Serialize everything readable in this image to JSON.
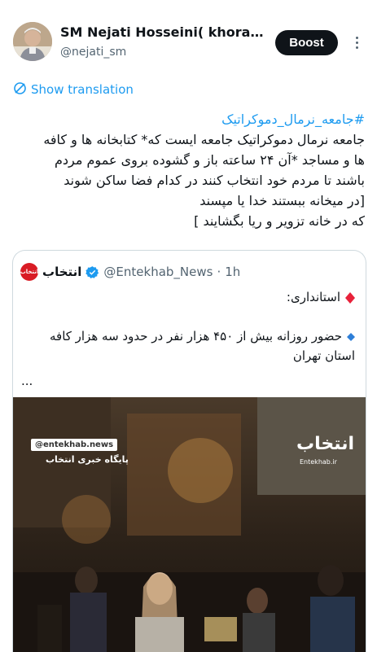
{
  "post": {
    "author_name": "SM Nejati Hosseini( khoras…",
    "author_handle": "@nejati_sm",
    "boost_label": "Boost",
    "more_icon": "more-options-icon",
    "translation_label": "Show translation",
    "hashtag": "#جامعه_نرمال_دموکراتیک",
    "body_lines": [
      "جامعه نرمال دموکراتیک جامعه ایست که* کتابخانه ها و کافه",
      "ها و مساجد *آن ۲۴ ساعته باز و گشوده بروی عموم مردم",
      "باشند تا مردم خود انتخاب کنند در کدام فضا ساکن شوند",
      "[در میخانه ببستند خدا یا مپسند",
      "که در خانه تزویر و ریا بگشایند ]"
    ]
  },
  "quote": {
    "avatar_text": "انتخاب",
    "name": "انتخاب",
    "handle": "@Entekhab_News",
    "separator": "·",
    "time": "1h",
    "line1": "استانداری:",
    "line2": "حضور روزانه بیش از ۴۵۰ هزار نفر در حدود سه هزار کافه",
    "line3": "استان تهران",
    "ellipsis": "...",
    "image": {
      "watermark_handle": "@entekhab.news",
      "watermark_sub": "پایگاه خبری انتخاب",
      "logo_text": "انتخاب",
      "logo_url": "Entekhab.ir"
    }
  },
  "colors": {
    "link": "#1d9bf0",
    "text": "#0f1419",
    "secondary": "#536471",
    "boost_bg": "#0f1419"
  }
}
